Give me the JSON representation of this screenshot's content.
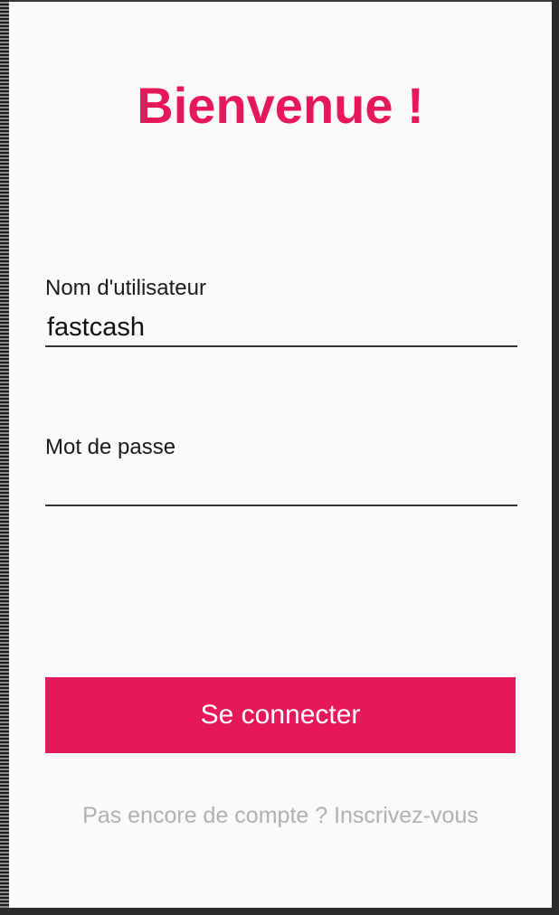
{
  "screen": {
    "title": "Bienvenue !"
  },
  "form": {
    "username": {
      "label": "Nom d'utilisateur",
      "value": "fastcash",
      "placeholder": ""
    },
    "password": {
      "label": "Mot de passe",
      "value": "",
      "placeholder": ""
    },
    "submit_label": "Se connecter",
    "signup_prompt": "Pas encore de compte ? Inscrivez-vous"
  },
  "colors": {
    "accent": "#e5195a",
    "background": "#fafafa",
    "muted_text": "#b0b0b0"
  }
}
